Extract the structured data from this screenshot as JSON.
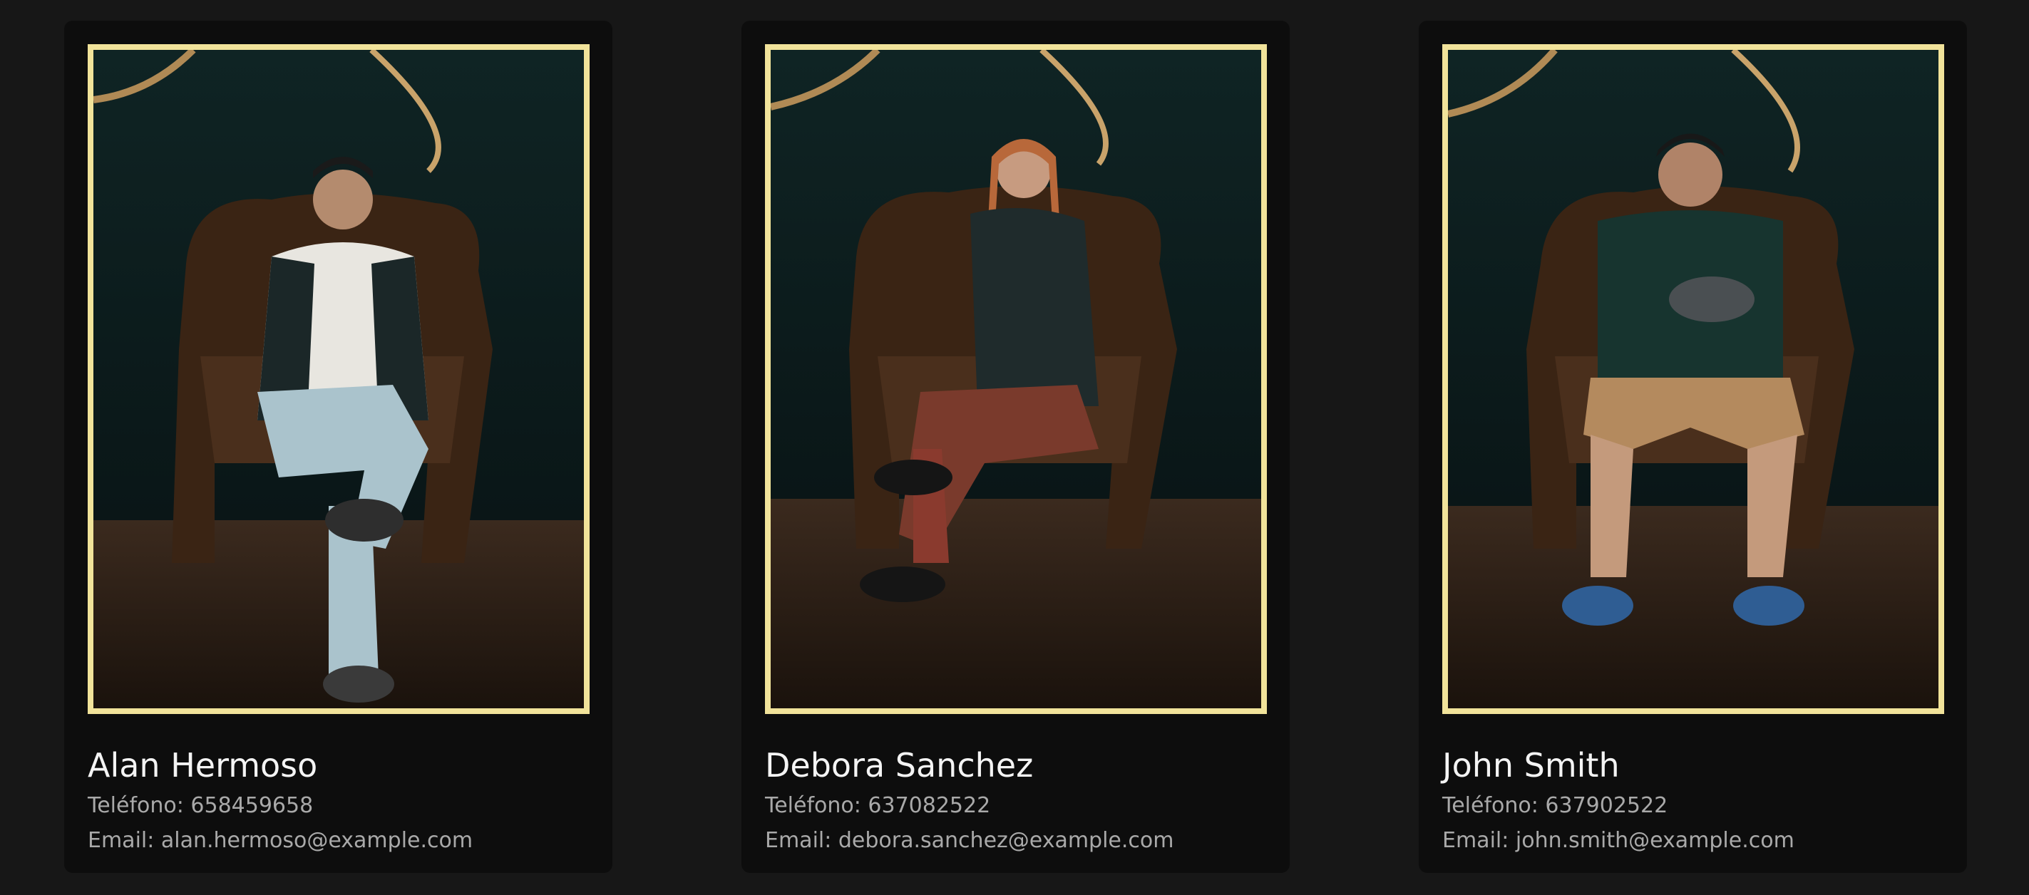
{
  "team": [
    {
      "name": "Alan Hermoso",
      "phone": "Teléfono: 658459658",
      "email": "Email: alan.hermoso@example.com",
      "photo_alt": "photo"
    },
    {
      "name": "Debora Sanchez",
      "phone": "Teléfono: 637082522",
      "email": "Email: debora.sanchez@example.com",
      "photo_alt": "photo"
    },
    {
      "name": "John Smith",
      "phone": "Teléfono: 637902522",
      "email": "Email: john.smith@example.com",
      "photo_alt": "photo"
    }
  ],
  "colors": {
    "page_background": "#171717",
    "card_background": "#0d0d0d",
    "photo_border": "#f1e39a",
    "name_text": "#f4f4f4",
    "detail_text": "#a9a9a9"
  }
}
